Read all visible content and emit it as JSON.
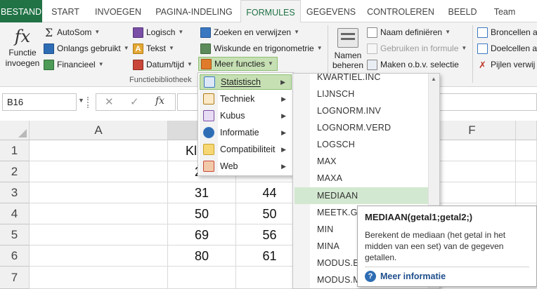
{
  "tabs": [
    {
      "label": "BESTAND"
    },
    {
      "label": "START"
    },
    {
      "label": "INVOEGEN"
    },
    {
      "label": "PAGINA-INDELING"
    },
    {
      "label": "FORMULES"
    },
    {
      "label": "GEGEVENS"
    },
    {
      "label": "CONTROLEREN"
    },
    {
      "label": "BEELD"
    },
    {
      "label": "Team"
    }
  ],
  "ribbon": {
    "insert_function": {
      "line1": "Functie",
      "line2": "invoegen",
      "icon": "fx"
    },
    "autosum": "AutoSom",
    "recent": "Onlangs gebruikt",
    "financial": "Financieel",
    "logical": "Logisch",
    "text": "Tekst",
    "datetime": "Datum/tijd",
    "lookup": "Zoeken en verwijzen",
    "math": "Wiskunde en trigonometrie",
    "more": "Meer functies",
    "group_label": "Functiebibliotheek",
    "name_manager": {
      "line1": "Namen",
      "line2": "beheren"
    },
    "define_name": "Naam definiëren",
    "use_in_formula": "Gebruiken in formule",
    "create_from_selection": "Maken o.b.v. selectie",
    "trace_precedents": "Broncellen a",
    "trace_dependents": "Doelcellen a",
    "remove_arrows": "Pijlen verwij"
  },
  "namebox": "B16",
  "formula_icons": {
    "cancel": "✕",
    "enter": "✓",
    "fx": "fx"
  },
  "columns": [
    "A",
    "",
    "",
    "",
    "F"
  ],
  "rows": [
    {
      "num": "1",
      "b": "Kl",
      "c": ""
    },
    {
      "num": "2",
      "b": "2",
      "c": ""
    },
    {
      "num": "3",
      "b": "31",
      "c": "44"
    },
    {
      "num": "4",
      "b": "50",
      "c": "50"
    },
    {
      "num": "5",
      "b": "69",
      "c": "56"
    },
    {
      "num": "6",
      "b": "80",
      "c": "61"
    },
    {
      "num": "7",
      "b": "",
      "c": ""
    }
  ],
  "more_menu": [
    {
      "label": "Statistisch",
      "icon": "stats-icon"
    },
    {
      "label": "Techniek",
      "icon": "engineering-icon"
    },
    {
      "label": "Kubus",
      "icon": "cube-icon"
    },
    {
      "label": "Informatie",
      "icon": "info-icon"
    },
    {
      "label": "Compatibiliteit",
      "icon": "compat-icon"
    },
    {
      "label": "Web",
      "icon": "web-icon"
    }
  ],
  "functions": [
    "KWARTIEL.INC",
    "LIJNSCH",
    "LOGNORM.INV",
    "LOGNORM.VERD",
    "LOGSCH",
    "MAX",
    "MAXA",
    "MEDIAAN",
    "MEETK.GEM",
    "MIN",
    "MINA",
    "MODUS.ENK",
    "MODUS.M"
  ],
  "tooltip": {
    "title": "MEDIAAN(getal1;getal2;)",
    "line1": "Berekent de mediaan (het getal in het",
    "line2": "midden van een set) van de gegeven",
    "line3": "getallen.",
    "link": "Meer informatie"
  },
  "colors": {
    "accent": "#217346",
    "highlight": "#c6e0b4",
    "menu_hover": "#d3e8d0"
  }
}
